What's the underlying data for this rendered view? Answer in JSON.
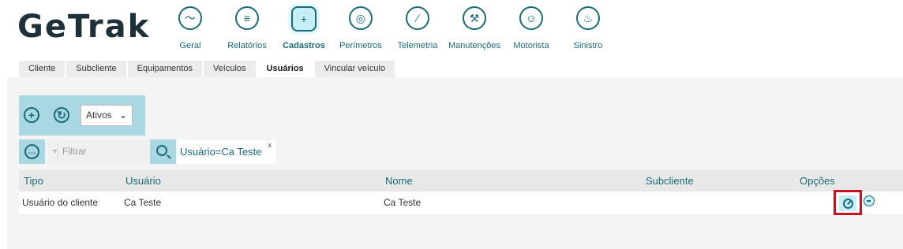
{
  "brand": {
    "logo": "GeTrak"
  },
  "nav": {
    "items": [
      {
        "label": "Geral",
        "icon": "dashboard-icon",
        "glyph": "〜"
      },
      {
        "label": "Relatórios",
        "icon": "report-icon",
        "glyph": "≡"
      },
      {
        "label": "Cadastros",
        "icon": "add-folder-icon",
        "glyph": "+",
        "active": true
      },
      {
        "label": "Perímetros",
        "icon": "target-icon",
        "glyph": "◎"
      },
      {
        "label": "Telemetria",
        "icon": "compass-icon",
        "glyph": "⁄"
      },
      {
        "label": "Manutenções",
        "icon": "wrench-icon",
        "glyph": "⚒"
      },
      {
        "label": "Motorista",
        "icon": "driver-icon",
        "glyph": "☺"
      },
      {
        "label": "Sinistro",
        "icon": "alarm-icon",
        "glyph": "♨"
      }
    ]
  },
  "tabs": {
    "items": [
      {
        "label": "Cliente"
      },
      {
        "label": "Subcliente"
      },
      {
        "label": "Equipamentos"
      },
      {
        "label": "Veículos"
      },
      {
        "label": "Usuários",
        "active": true
      },
      {
        "label": "Vincular veículo"
      }
    ]
  },
  "toolbar": {
    "add_icon": "plus-icon",
    "refresh_icon": "refresh-icon",
    "status_select": {
      "value": "Ativos"
    }
  },
  "filter": {
    "placeholder": "Filtrar",
    "chip": {
      "label": "Usuário=Ca Teste",
      "close": "x"
    }
  },
  "table": {
    "columns": [
      "Tipo",
      "Usuário",
      "Nome",
      "Subcliente",
      "Opções"
    ],
    "rows": [
      {
        "tipo": "Usuário do cliente",
        "usuario": "Ca Teste",
        "nome": "Ca Teste",
        "subcliente": ""
      }
    ]
  },
  "colors": {
    "accent": "#1a6a78",
    "toolbar_bg": "#a9d8e3",
    "highlight_border": "#c5141d"
  }
}
